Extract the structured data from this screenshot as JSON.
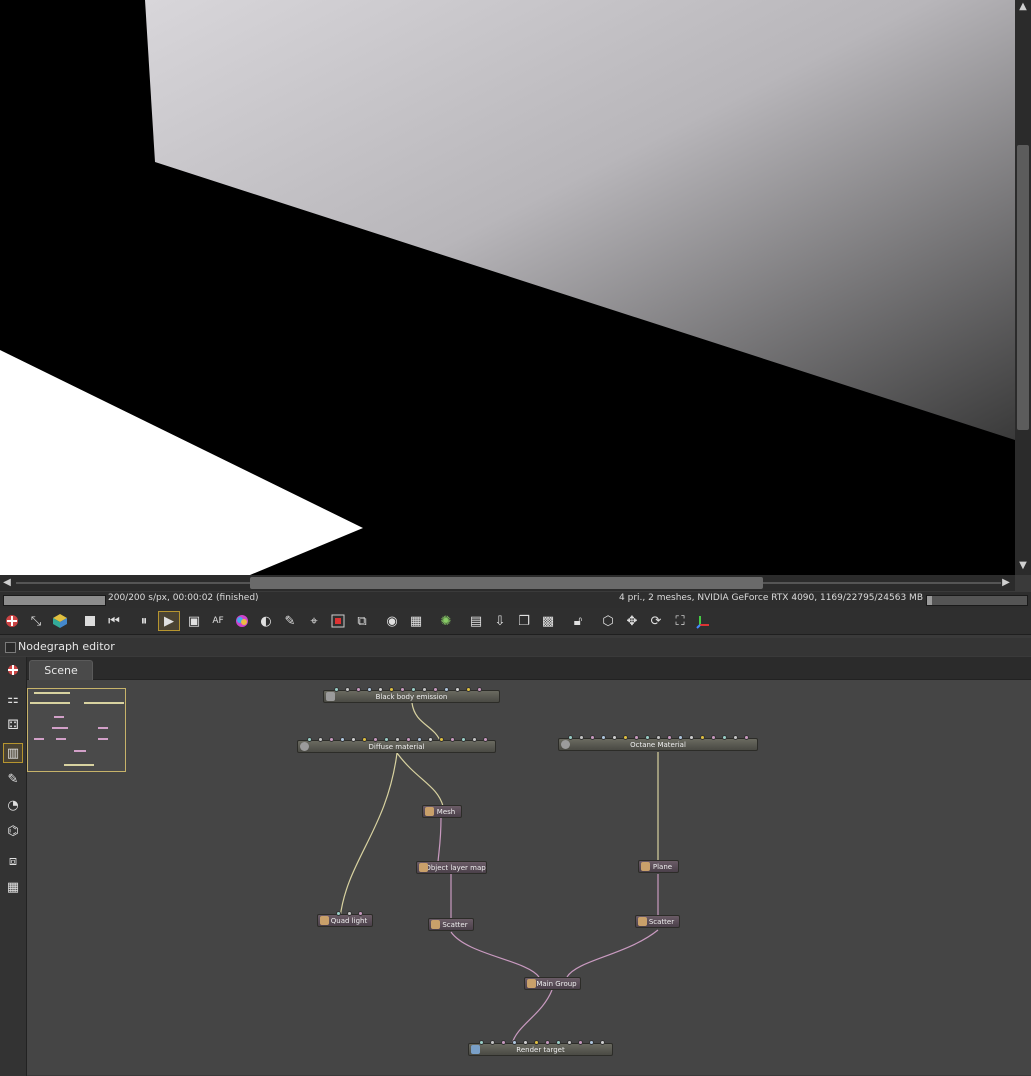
{
  "status": {
    "render_progress_text": "200/200 s/px, 00:00:02 (finished)",
    "render_progress_fraction": 1.0,
    "device_info": "4 pri., 2 meshes, NVIDIA GeForce RTX 4090, 1169/22795/24563 MB",
    "memory_fraction": 0.05
  },
  "toolbar": {
    "icons": [
      "octane-logo-icon",
      "collapse-icon",
      "cube-color-icon",
      "stop-icon",
      "rewind-icon",
      "pause-icon",
      "play-icon",
      "display-icon",
      "af-icon",
      "color-wheel-icon",
      "sphere-icon",
      "light-icon",
      "light-pick-icon",
      "region-icon",
      "camera-icon",
      "lens-icon",
      "render-region-icon",
      "gauge-icon",
      "clipboard-icon",
      "export-icon",
      "layers-icon",
      "checker-icon",
      "lock-icon",
      "cube-icon",
      "move-icon",
      "rotate-icon",
      "fit-icon",
      "axis-icon"
    ]
  },
  "nodegraph": {
    "title": "Nodegraph editor",
    "tab": "Scene",
    "nodes": {
      "black_body_emission": "Black body emission",
      "diffuse_material": "Diffuse material",
      "octane_material": "Octane Material",
      "mesh": "Mesh",
      "object_layer_map": "Object layer map",
      "plane": "Plane",
      "quad_light": "Quad light",
      "scatter_left": "Scatter",
      "scatter_right": "Scatter",
      "main_group": "Main Group",
      "render_target": "Render target"
    }
  },
  "colors": {
    "accent": "#b6952f",
    "wire_material": "#d8d2a0",
    "wire_geometry": "#c99ac0"
  }
}
